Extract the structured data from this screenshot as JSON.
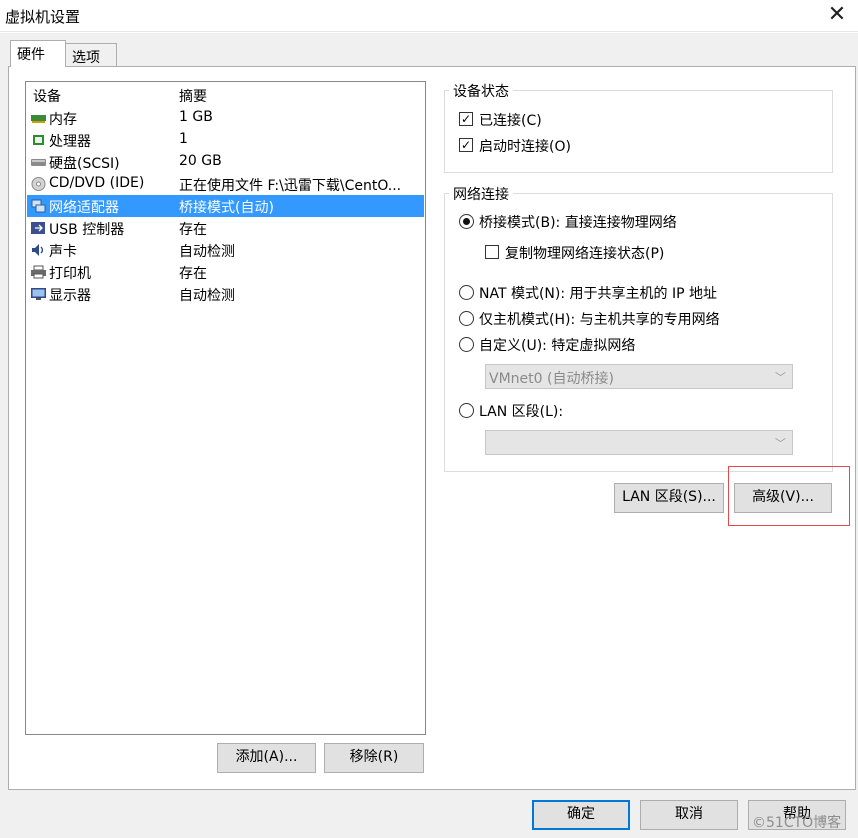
{
  "window": {
    "title": "虚拟机设置",
    "close_glyph": "✕"
  },
  "tabs": [
    {
      "label": "硬件",
      "active": true
    },
    {
      "label": "选项",
      "active": false
    }
  ],
  "device_list": {
    "columns": [
      "设备",
      "摘要"
    ],
    "rows": [
      {
        "device": "内存",
        "summary": "1 GB",
        "icon": "memory-icon"
      },
      {
        "device": "处理器",
        "summary": "1",
        "icon": "processor-icon"
      },
      {
        "device": "硬盘(SCSI)",
        "summary": "20 GB",
        "icon": "harddisk-icon"
      },
      {
        "device": "CD/DVD (IDE)",
        "summary": "正在使用文件 F:\\迅雷下载\\CentO...",
        "icon": "cdrom-icon"
      },
      {
        "device": "网络适配器",
        "summary": "桥接模式(自动)",
        "icon": "network-adapter-icon",
        "selected": true
      },
      {
        "device": "USB 控制器",
        "summary": "存在",
        "icon": "usb-icon"
      },
      {
        "device": "声卡",
        "summary": "自动检测",
        "icon": "sound-card-icon"
      },
      {
        "device": "打印机",
        "summary": "存在",
        "icon": "printer-icon"
      },
      {
        "device": "显示器",
        "summary": "自动检测",
        "icon": "display-icon"
      }
    ]
  },
  "list_buttons": {
    "add": "添加(A)...",
    "remove": "移除(R)"
  },
  "device_status": {
    "legend": "设备状态",
    "connected": {
      "label": "已连接(C)",
      "checked": true
    },
    "connect_at_power_on": {
      "label": "启动时连接(O)",
      "checked": true
    }
  },
  "network": {
    "legend": "网络连接",
    "bridged": {
      "label": "桥接模式(B): 直接连接物理网络",
      "selected": true
    },
    "replicate": {
      "label": "复制物理网络连接状态(P)",
      "checked": false
    },
    "nat": {
      "label": "NAT 模式(N): 用于共享主机的 IP 地址",
      "selected": false
    },
    "host_only": {
      "label": "仅主机模式(H): 与主机共享的专用网络",
      "selected": false
    },
    "custom": {
      "label": "自定义(U): 特定虚拟网络",
      "selected": false
    },
    "custom_select": "VMnet0 (自动桥接)",
    "lan_segment": {
      "label": "LAN 区段(L):",
      "selected": false
    },
    "lan_select": ""
  },
  "action_buttons": {
    "lan_segments": "LAN 区段(S)...",
    "advanced": "高级(V)..."
  },
  "footer_buttons": {
    "ok": "确定",
    "cancel": "取消",
    "help": "帮助"
  },
  "watermark": "©51CTO博客",
  "colors": {
    "selection": "#3399ff",
    "default_button_border": "#0078d7",
    "highlight_box": "#e24a4a"
  }
}
